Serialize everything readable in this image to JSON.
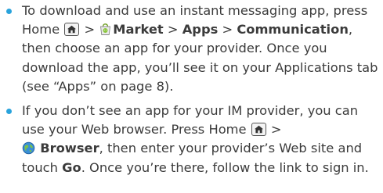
{
  "bullet_color": "#29a3dc",
  "items": [
    {
      "t1": "To download and use an instant messaging app, press Home ",
      "t2": " > ",
      "market": "Market",
      "t3": " > ",
      "apps": "Apps",
      "t4": " > ",
      "communication": "Communication",
      "t5": ", then choose an app for your provider. Once you download the app, you’ll see it on your Applications tab (see “Apps” on page 8)."
    },
    {
      "t1": "If you don’t see an app for your IM provider, you can use your Web browser. Press Home ",
      "t2": " > ",
      "browser": "Browser",
      "t3": ", then enter your provider’s Web site and touch ",
      "go": "Go",
      "t4": ". Once you’re there, follow the link to sign in."
    }
  ],
  "icons": {
    "home": "home-key-icon",
    "market": "market-bag-icon",
    "browser": "browser-globe-icon"
  }
}
